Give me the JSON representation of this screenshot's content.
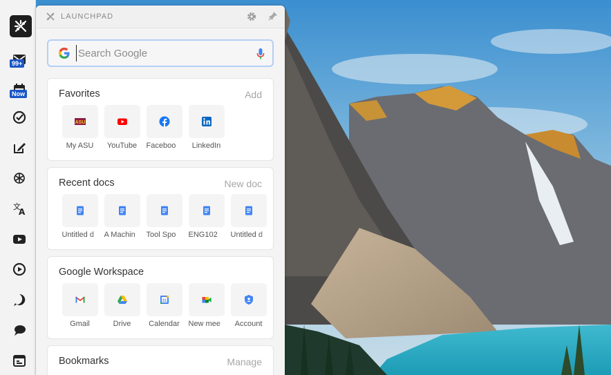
{
  "rail": {
    "items": [
      {
        "icon": "launchpad-logo-icon"
      },
      {
        "icon": "mail-icon",
        "badge": "99+"
      },
      {
        "icon": "calendar-icon",
        "badge": "Now"
      },
      {
        "icon": "tasks-check-icon"
      },
      {
        "icon": "edit-note-icon"
      },
      {
        "icon": "chatgpt-icon"
      },
      {
        "icon": "translate-icon"
      },
      {
        "icon": "youtube-icon"
      },
      {
        "icon": "media-play-icon"
      },
      {
        "icon": "whatsapp-icon"
      },
      {
        "icon": "chat-bubbles-icon"
      },
      {
        "icon": "browser-window-icon"
      }
    ]
  },
  "panel": {
    "title": "LAUNCHPAD",
    "search": {
      "placeholder": "Search Google"
    },
    "favorites": {
      "title": "Favorites",
      "action": "Add",
      "items": [
        {
          "label": "My ASU",
          "icon": "asu-icon"
        },
        {
          "label": "YouTube",
          "icon": "youtube-icon"
        },
        {
          "label": "Faceboo",
          "icon": "facebook-icon"
        },
        {
          "label": "LinkedIn",
          "icon": "linkedin-icon"
        }
      ]
    },
    "recent_docs": {
      "title": "Recent docs",
      "action": "New doc",
      "items": [
        {
          "label": "Untitled d",
          "icon": "google-docs-icon"
        },
        {
          "label": "A Machin",
          "icon": "google-docs-icon"
        },
        {
          "label": "Tool Spo",
          "icon": "google-docs-icon"
        },
        {
          "label": "ENG102 ",
          "icon": "google-docs-icon"
        },
        {
          "label": "Untitled d",
          "icon": "google-docs-icon"
        }
      ]
    },
    "workspace": {
      "title": "Google Workspace",
      "items": [
        {
          "label": "Gmail",
          "icon": "gmail-icon"
        },
        {
          "label": "Drive",
          "icon": "drive-icon"
        },
        {
          "label": "Calendar",
          "icon": "calendar-icon"
        },
        {
          "label": "New mee",
          "icon": "meet-icon"
        },
        {
          "label": "Account",
          "icon": "account-shield-icon"
        }
      ]
    },
    "bookmarks": {
      "title": "Bookmarks",
      "action": "Manage"
    }
  },
  "colors": {
    "accent": "#1a56c8",
    "docs_blue": "#4285f4",
    "search_border": "#b5cef5"
  }
}
